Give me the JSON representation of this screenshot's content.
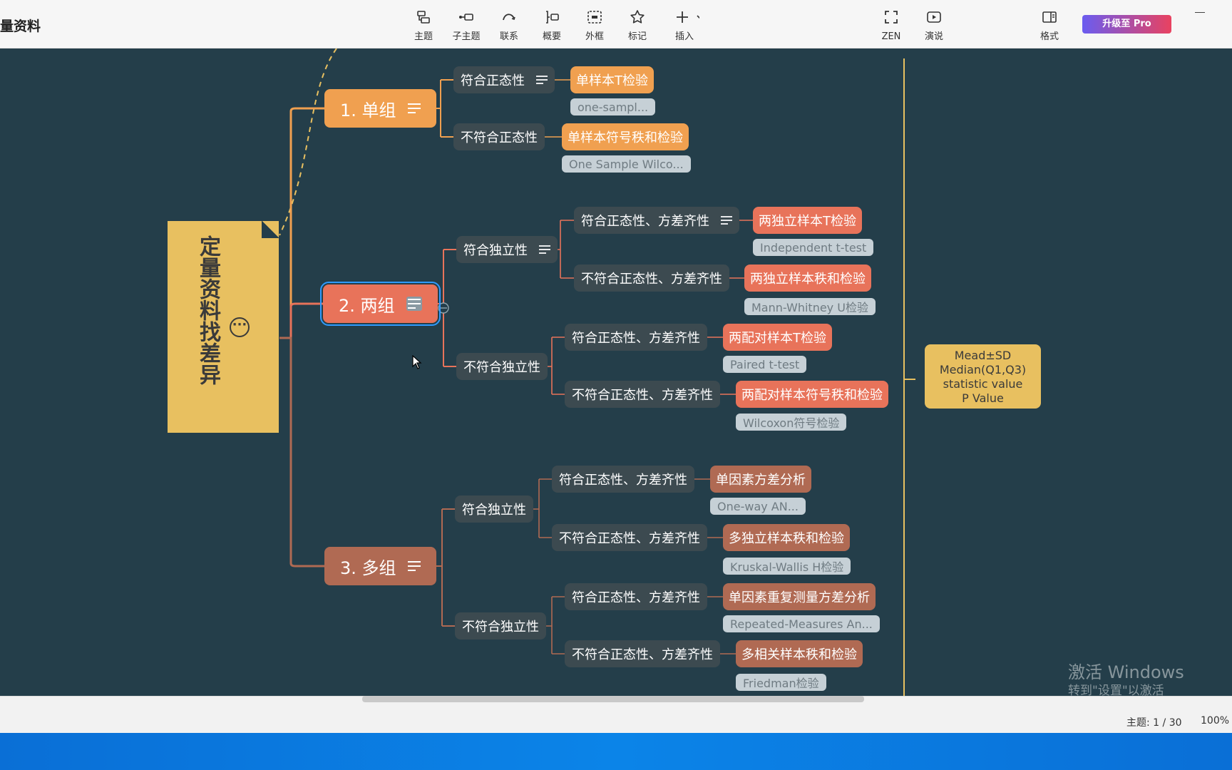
{
  "app": {
    "title": "量资料"
  },
  "toolbar": {
    "items": [
      {
        "label": "主题",
        "icon": "topic-icon"
      },
      {
        "label": "子主题",
        "icon": "subtopic-icon"
      },
      {
        "label": "联系",
        "icon": "relationship-icon"
      },
      {
        "label": "概要",
        "icon": "summary-icon"
      },
      {
        "label": "外框",
        "icon": "boundary-icon"
      },
      {
        "label": "标记",
        "icon": "star-icon"
      },
      {
        "label": "插入",
        "icon": "plus-icon"
      }
    ],
    "zen": "ZEN",
    "present": "演说",
    "format": "格式",
    "upgrade": "升级至 Pro"
  },
  "colors": {
    "canvas": "#243e4a",
    "root": "#e8c060",
    "branch1": "#f0a050",
    "branch2": "#e8735a",
    "branch3": "#b06a53",
    "selection": "#2f9bff"
  },
  "map": {
    "root": "定量资料找差异",
    "branches": [
      {
        "label": "1. 单组",
        "children": [
          {
            "cond": "符合正态性",
            "method": "单样本T检验",
            "label": "one-sampl..."
          },
          {
            "cond": "不符合正态性",
            "method": "单样本符号秩和检验",
            "label": "One Sample Wilco..."
          }
        ]
      },
      {
        "label": "2. 两组",
        "groups": [
          {
            "label": "符合独立性",
            "children": [
              {
                "cond": "符合正态性、方差齐性",
                "method": "两独立样本T检验",
                "label": "Independent t-test"
              },
              {
                "cond": "不符合正态性、方差齐性",
                "method": "两独立样本秩和检验",
                "label": "Mann-Whitney U检验"
              }
            ]
          },
          {
            "label": "不符合独立性",
            "children": [
              {
                "cond": "符合正态性、方差齐性",
                "method": "两配对样本T检验",
                "label": "Paired t-test"
              },
              {
                "cond": "不符合正态性、方差齐性",
                "method": "两配对样本符号秩和检验",
                "label": "Wilcoxon符号检验"
              }
            ]
          }
        ]
      },
      {
        "label": "3. 多组",
        "groups": [
          {
            "label": "符合独立性",
            "children": [
              {
                "cond": "符合正态性、方差齐性",
                "method": "单因素方差分析",
                "label": "One-way AN..."
              },
              {
                "cond": "不符合正态性、方差齐性",
                "method": "多独立样本秩和检验",
                "label": "Kruskal-Wallis H检验"
              }
            ]
          },
          {
            "label": "不符合独立性",
            "children": [
              {
                "cond": "符合正态性、方差齐性",
                "method": "单因素重复测量方差分析",
                "label": "Repeated-Measures An..."
              },
              {
                "cond": "不符合正态性、方差齐性",
                "method": "多相关样本秩和检验",
                "label": "Friedman检验"
              }
            ]
          }
        ]
      }
    ],
    "summary": [
      "Mead±SD",
      "Median(Q1,Q3)",
      "statistic value",
      "P Value"
    ]
  },
  "status": {
    "topics": "主题: 1 / 30",
    "zoom": "100%"
  },
  "watermark": {
    "line1": "激活 Windows",
    "line2": "转到\"设置\"以激活 Windows。"
  }
}
